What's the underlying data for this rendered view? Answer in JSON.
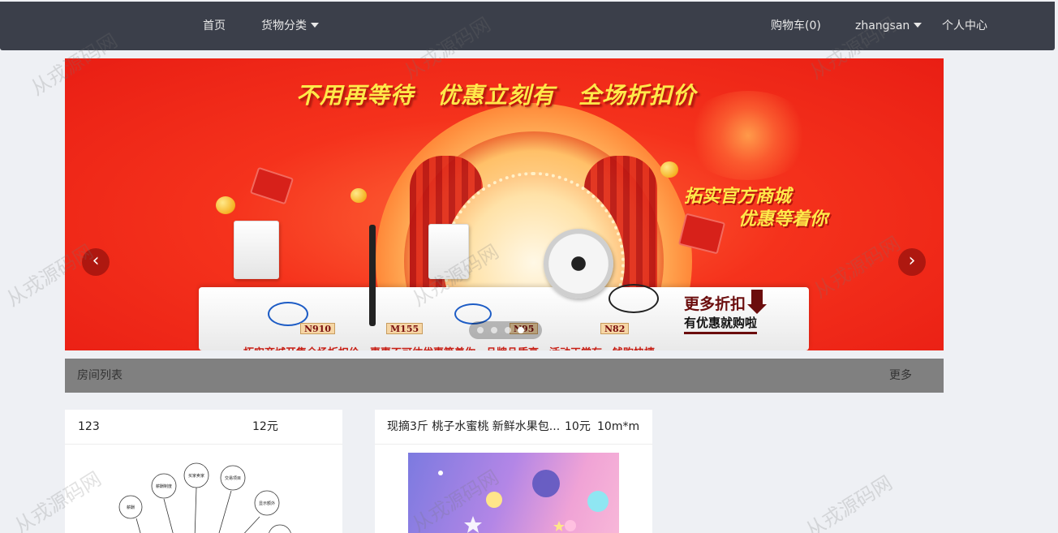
{
  "nav": {
    "home": "首页",
    "categories": "货物分类",
    "cart": "购物车(0)",
    "user": "zhangsan",
    "profile": "个人中心"
  },
  "banner": {
    "slogan": "不用再等待　优惠立刻有　全场折扣价",
    "mall_line1": "拓实官方商城",
    "mall_line2": "优惠等着你",
    "promo_big": "更多折扣",
    "promo_small": "有优惠就购啦",
    "products": [
      "N910",
      "M155",
      "N95",
      "N82"
    ],
    "stage_text": "拓实商城开集全场折扣价　惠惠不可估优惠等着你　品牌品质高　活动正常有　钱购快捷",
    "prev_icon": "chevron-left-icon",
    "next_icon": "chevron-right-icon",
    "slides_total": 4,
    "active_slide": 2
  },
  "section": {
    "title": "房间列表",
    "more": "更多"
  },
  "cards": [
    {
      "name": "123",
      "price": "12元",
      "size": ""
    },
    {
      "name": "现摘3斤 桃子水蜜桃 新鲜水果包...",
      "price": "10元",
      "size": "10m*m"
    }
  ],
  "mindmap_nodes": [
    "薪酬",
    "薪酬制度",
    "买家卖家",
    "交易项目",
    "显示额外"
  ],
  "watermark": "从戎源码网",
  "colors": {
    "nav_bg": "#3b3f4a",
    "page_bg": "#eef0f4",
    "section_bar": "#808080",
    "banner_red": "#e91e14",
    "slogan_yellow": "#ffe94a"
  }
}
